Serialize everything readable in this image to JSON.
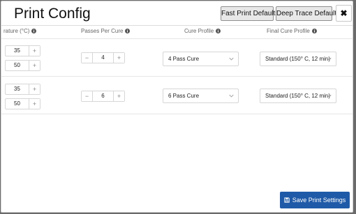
{
  "dialog": {
    "title": "Print Config",
    "fast_defaults_label": "Fast Print Defaults",
    "deep_defaults_label": "Deep Trace Defaults",
    "close_glyph": "✖",
    "save_label": "Save Print Settings"
  },
  "columns": {
    "temperature": "rature (°C)",
    "passes": "Passes Per Cure",
    "cure_profile": "Cure Profile",
    "final_cure_profile": "Final Cure Profile"
  },
  "rows": [
    {
      "temp_top": "35",
      "temp_bottom": "50",
      "passes": "4",
      "cure_profile": "4 Pass Cure",
      "final_cure_profile": "Standard (150° C, 12 min)"
    },
    {
      "temp_top": "35",
      "temp_bottom": "50",
      "passes": "6",
      "cure_profile": "6 Pass Cure",
      "final_cure_profile": "Standard (150° C, 12 min)"
    }
  ],
  "stepper": {
    "minus": "−",
    "plus": "+"
  },
  "colors": {
    "primary": "#1f5aa8",
    "overlay": "#6b6b6b",
    "button_bg": "#e8e8e8"
  },
  "icons": {
    "info": "info-circle-icon",
    "chevron": "chevron-down-icon",
    "save": "floppy-disk-icon",
    "close": "close-icon"
  }
}
